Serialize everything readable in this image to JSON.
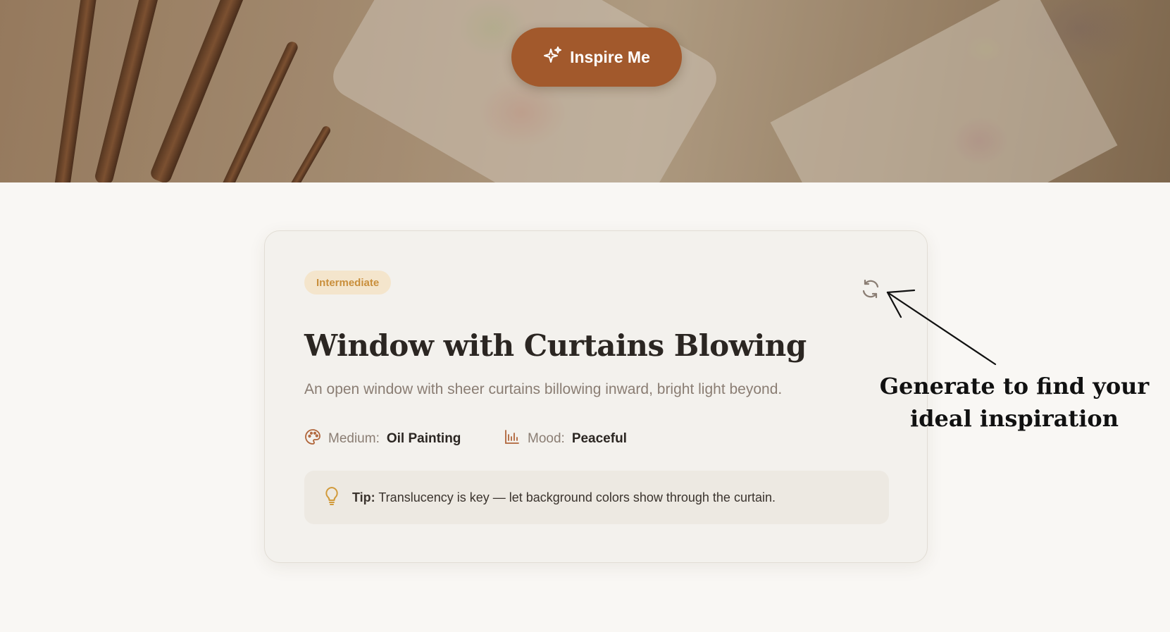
{
  "hero": {
    "button_label": "Inspire Me",
    "button_color": "#a2592c",
    "button_icon": "sparkles-icon"
  },
  "card": {
    "difficulty_badge": "Intermediate",
    "refresh_icon": "refresh-icon",
    "title": "Window with Curtains Blowing",
    "description": "An open window with sheer curtains billowing inward, bright light beyond.",
    "medium": {
      "icon": "palette-icon",
      "label": "Medium:",
      "value": "Oil Painting"
    },
    "mood": {
      "icon": "bar-chart-icon",
      "label": "Mood:",
      "value": "Peaceful"
    },
    "tip": {
      "icon": "lightbulb-icon",
      "key": "Tip:",
      "text": "Translucency is key — let background colors show through the curtain."
    },
    "accent_color": "#b0653a",
    "badge_color": "#c98f3c"
  },
  "annotation": {
    "line1": "Generate to find your",
    "line2": "ideal inspiration"
  }
}
